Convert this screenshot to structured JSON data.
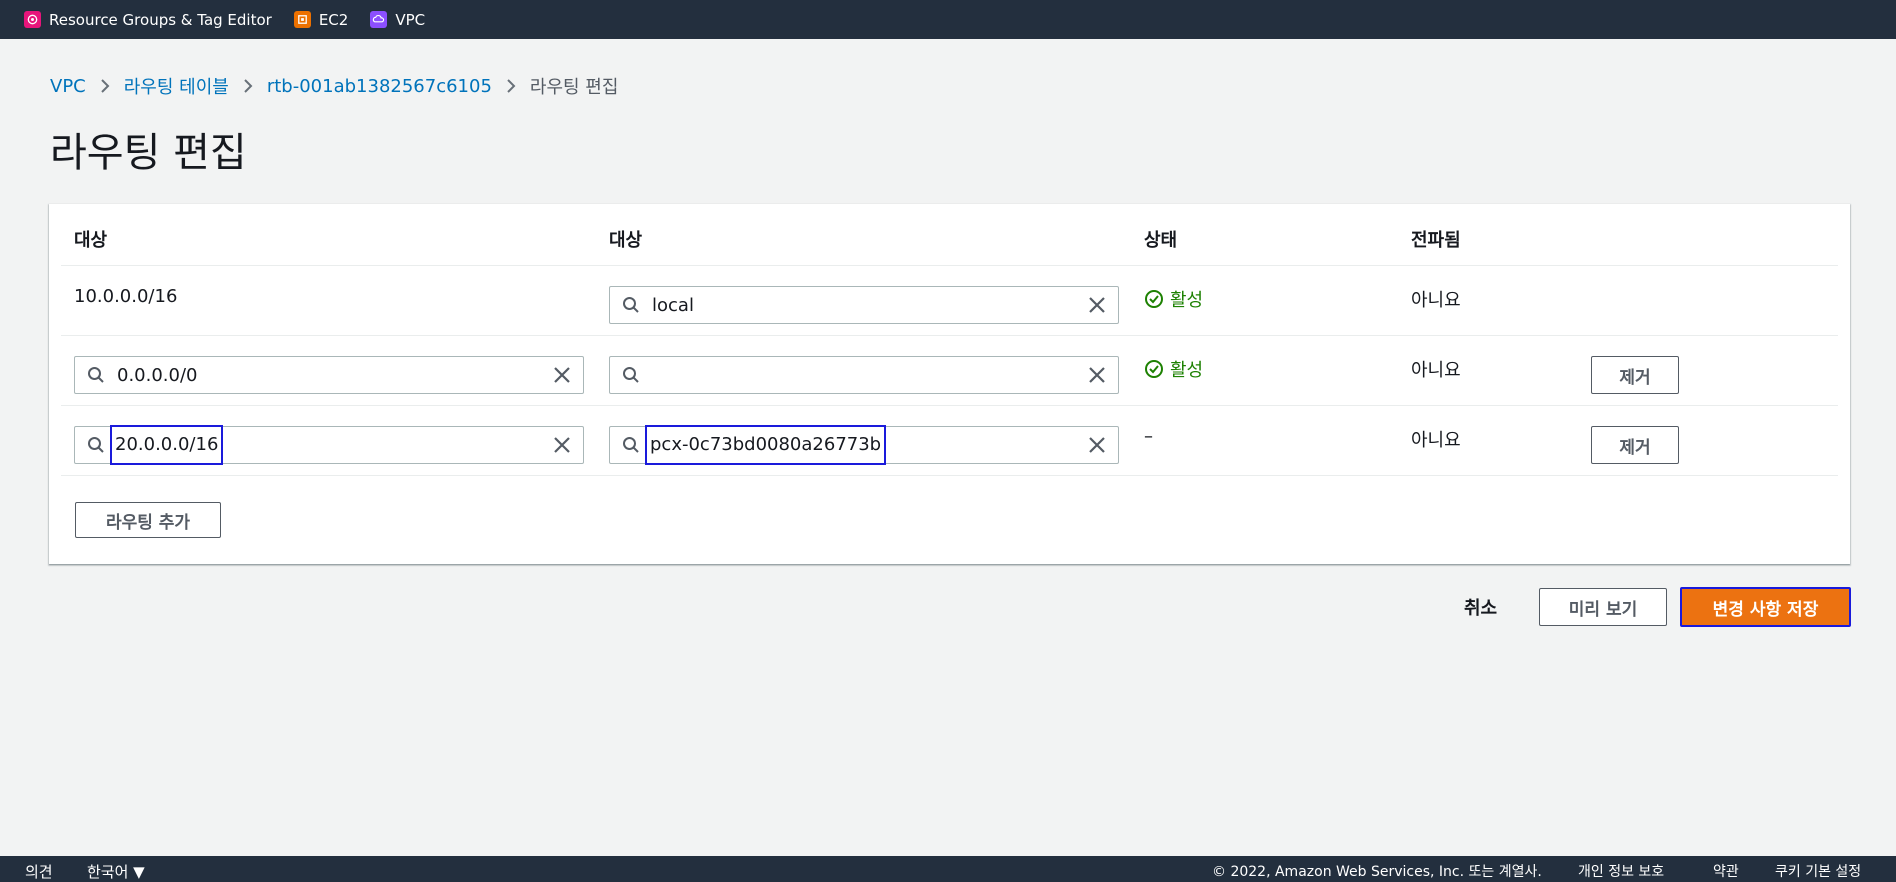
{
  "topbar": {
    "favorites": [
      {
        "label": "Resource Groups & Tag Editor",
        "icon": "resource-groups-icon",
        "color": "#e7157b"
      },
      {
        "label": "EC2",
        "icon": "ec2-icon",
        "color": "#ed7100"
      },
      {
        "label": "VPC",
        "icon": "vpc-icon",
        "color": "#8c4fff"
      }
    ]
  },
  "breadcrumb": {
    "items": [
      "VPC",
      "라우팅 테이블",
      "rtb-001ab1382567c6105"
    ],
    "current": "라우팅 편집"
  },
  "page_title": "라우팅 편집",
  "table": {
    "headers": [
      "대상",
      "대상",
      "상태",
      "전파됨"
    ],
    "rows": [
      {
        "destination": "10.0.0.0/16",
        "target": "local",
        "status": "활성",
        "propagated": "아니요"
      },
      {
        "destination": "0.0.0.0/0",
        "target": "",
        "status": "활성",
        "propagated": "아니요",
        "remove": "제거"
      },
      {
        "destination": "20.0.0.0/16",
        "target": "pcx-0c73bd0080a26773b",
        "status": "–",
        "propagated": "아니요",
        "remove": "제거"
      }
    ],
    "add_route": "라우팅 추가"
  },
  "actions": {
    "cancel": "취소",
    "preview": "미리 보기",
    "save": "변경 사항 저장"
  },
  "footer": {
    "feedback": "의견",
    "language": "한국어 ▼",
    "copyright": "© 2022, Amazon Web Services, Inc. 또는 계열사.",
    "privacy": "개인 정보 보호",
    "terms": "약관",
    "cookies": "쿠키 기본 설정"
  },
  "colors": {
    "nav": "#232f3e",
    "link": "#0073bb",
    "success": "#1d8102",
    "primary": "#ec7211",
    "highlight": "#1a1adb"
  }
}
